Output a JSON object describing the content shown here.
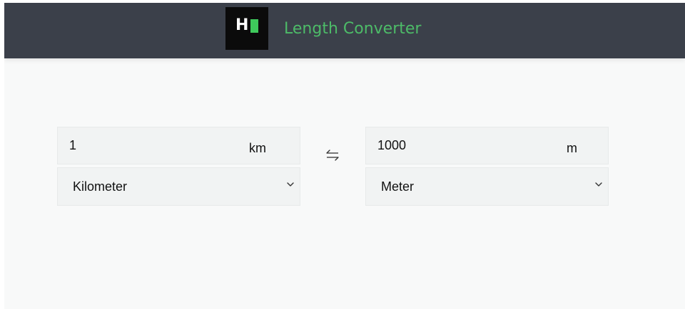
{
  "header": {
    "logo_letter": "H",
    "title": "Length Converter"
  },
  "left": {
    "value": "1",
    "unit": "km",
    "selected_unit": "Kilometer"
  },
  "swap_icon": "swap-arrows-icon",
  "right": {
    "value": "1000",
    "unit": "m",
    "selected_unit": "Meter"
  },
  "colors": {
    "header_bg": "#3b404a",
    "accent_green": "#4dbb68",
    "logo_green": "#3ec95b",
    "page_bg": "#f8f9f9",
    "field_bg": "#f1f3f3"
  }
}
